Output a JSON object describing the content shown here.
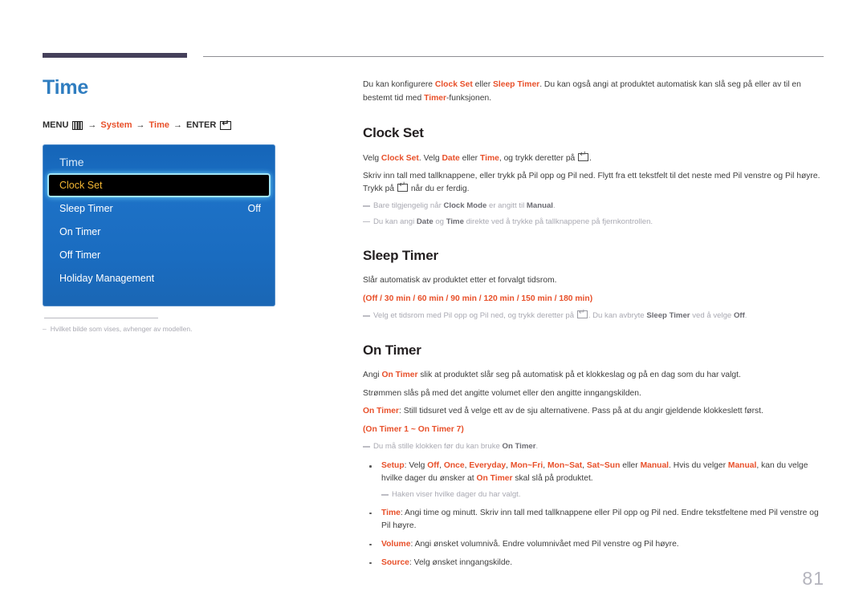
{
  "page": {
    "number": "81",
    "title": "Time"
  },
  "breadcrumb": {
    "menu_label": "MENU",
    "menu_icon": "menu-grid-icon",
    "arrow": "→",
    "step1": "System",
    "step2": "Time",
    "enter_label": "ENTER",
    "enter_icon": "enter-key-icon"
  },
  "osd": {
    "title": "Time",
    "items": [
      {
        "label": "Clock Set",
        "value": "",
        "selected": true
      },
      {
        "label": "Sleep Timer",
        "value": "Off",
        "selected": false
      },
      {
        "label": "On Timer",
        "value": "",
        "selected": false
      },
      {
        "label": "Off Timer",
        "value": "",
        "selected": false
      },
      {
        "label": "Holiday Management",
        "value": "",
        "selected": false
      }
    ]
  },
  "left_footnote": {
    "dash": "–",
    "text": "Hvilket bilde som vises, avhenger av modellen."
  },
  "intro": {
    "t1": "Du kan konfigurere ",
    "b1": "Clock Set",
    "t2": " eller ",
    "b2": "Sleep Timer",
    "t3": ". Du kan også angi at produktet automatisk kan slå seg på eller av til en bestemt tid med ",
    "b3": "Timer",
    "t4": "-funksjonen."
  },
  "clock_set": {
    "heading": "Clock Set",
    "p1": {
      "t1": "Velg ",
      "b1": "Clock Set",
      "t2": ". Velg ",
      "b2": "Date",
      "t3": " eller ",
      "b3": "Time",
      "t4": ", og trykk deretter på ",
      "t5": "."
    },
    "p2": {
      "t1": "Skriv inn tall med tallknappene, eller trykk på Pil opp og Pil ned. Flytt fra ett tekstfelt til det neste med Pil venstre og Pil høyre. Trykk på ",
      "t2": " når du er ferdig."
    },
    "note1": {
      "t1": "Bare tilgjengelig når ",
      "b1": "Clock Mode",
      "t2": " er angitt til ",
      "b2": "Manual",
      "t3": "."
    },
    "note2": {
      "t1": "Du kan angi ",
      "b1": "Date",
      "t2": " og ",
      "b2": "Time",
      "t3": " direkte ved å trykke på tallknappene på fjernkontrollen."
    }
  },
  "sleep_timer": {
    "heading": "Sleep Timer",
    "p1": "Slår automatisk av produktet etter et forvalgt tidsrom.",
    "options": "(Off / 30 min / 60 min / 90 min / 120 min / 150 min / 180 min)",
    "note1": {
      "t1": "Velg et tidsrom med Pil opp og Pil ned, og trykk deretter på ",
      "t2": ". Du kan avbryte ",
      "b1": "Sleep Timer",
      "t3": " ved å velge ",
      "b2": "Off",
      "t4": "."
    }
  },
  "on_timer": {
    "heading": "On Timer",
    "p1": {
      "t1": "Angi ",
      "b1": "On Timer",
      "t2": " slik at produktet slår seg på automatisk på et klokkeslag og på en dag som du har valgt."
    },
    "p2": "Strømmen slås på med det angitte volumet eller den angitte inngangskilden.",
    "p3": {
      "b1": "On Timer",
      "t1": ": Still tidsuret ved å velge ett av de sju alternativene. Pass på at du angir gjeldende klokkeslett først."
    },
    "range": "(On Timer 1 ~ On Timer 7)",
    "note1": {
      "t1": "Du må stille klokken før du kan bruke ",
      "b1": "On Timer",
      "t2": "."
    },
    "bullets": [
      {
        "label": "Setup",
        "t1": ": Velg ",
        "opts": [
          "Off",
          "Once",
          "Everyday",
          "Mon~Fri",
          "Mon~Sat",
          "Sat~Sun"
        ],
        "t2": " eller ",
        "b_manual": "Manual",
        "t3": ". Hvis du velger ",
        "b_manual2": "Manual",
        "t4": ", kan du velge hvilke dager du ønsker at ",
        "b_ontimer": "On Timer",
        "t5": " skal slå på produktet.",
        "note": "Haken viser hvilke dager du har valgt."
      },
      {
        "label": "Time",
        "t1": ": Angi time og minutt. Skriv inn tall med tallknappene eller Pil opp og Pil ned. Endre tekstfeltene med Pil venstre og Pil høyre."
      },
      {
        "label": "Volume",
        "t1": ": Angi ønsket volumnivå. Endre volumnivået med Pil venstre og Pil høyre."
      },
      {
        "label": "Source",
        "t1": ": Velg ønsket inngangskilde."
      }
    ]
  },
  "colors": {
    "accent_orange": "#e8502a",
    "title_blue": "#2f7dc0",
    "rule_purple": "#45405a",
    "osd_blue": "#1a6cc0",
    "osd_highlight_text": "#f2b632",
    "note_gray": "#a9a9b2"
  }
}
